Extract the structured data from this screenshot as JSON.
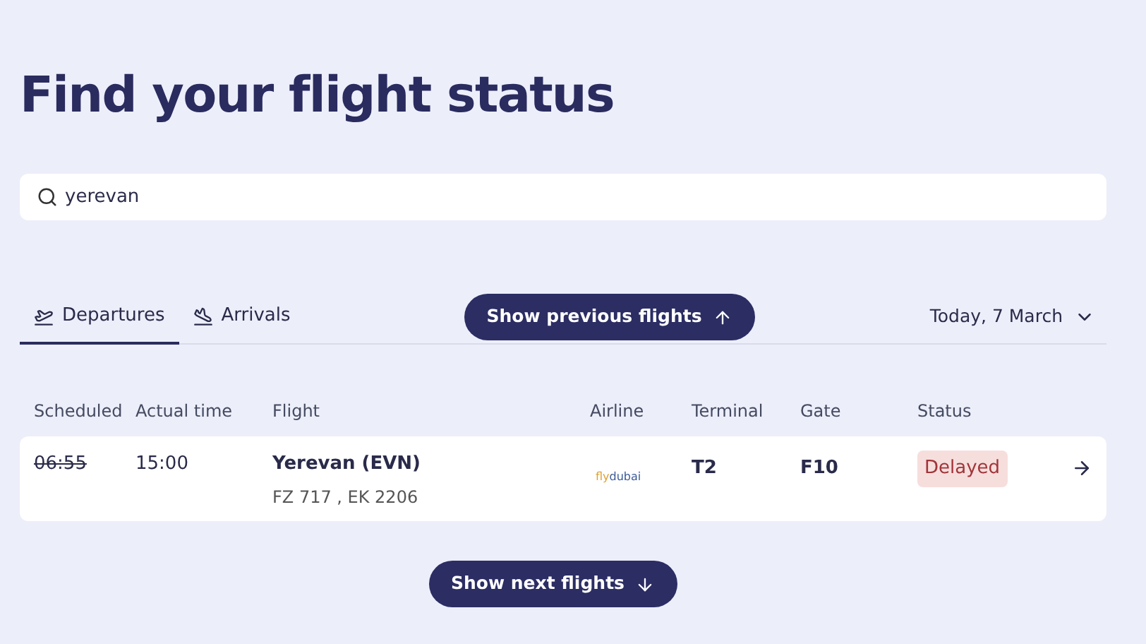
{
  "title": "Find your flight status",
  "search": {
    "value": "yerevan"
  },
  "tabs": [
    {
      "label": "Departures",
      "kind": "departure",
      "selected": true
    },
    {
      "label": "Arrivals",
      "kind": "arrival",
      "selected": false
    }
  ],
  "previous_button": "Show previous flights",
  "date_picker": "Today, 7 March",
  "table": {
    "columns": [
      "Scheduled",
      "Actual time",
      "Flight",
      "Airline",
      "Terminal",
      "Gate",
      "Status"
    ],
    "rows": [
      {
        "scheduled": "06:55",
        "actual": "15:00",
        "flight": "Yerevan (EVN)",
        "codes": "FZ 717 , EK 2206",
        "airline": "flydubai",
        "terminal": "T2",
        "gate": "F10",
        "status": "Delayed",
        "delayed": true
      }
    ]
  },
  "next_button": "Show next flights"
}
